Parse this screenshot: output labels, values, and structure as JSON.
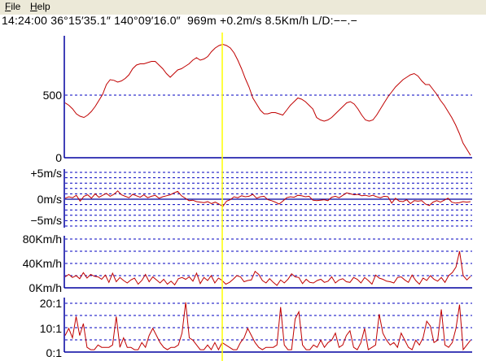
{
  "menu": {
    "file_label": "File",
    "file_mnemonic": "F",
    "file_rest": "ile",
    "help_label": "Help",
    "help_mnemonic": "H",
    "help_rest": "elp"
  },
  "status": {
    "time": "14:24:00",
    "latitude": "36°15′35.1″",
    "longitude": "140°09′16.0″",
    "altitude": "969m",
    "vario": "+0.2m/s",
    "speed": "8.5Km/h",
    "glide": "L/D:−−.−"
  },
  "colors": {
    "trace": "#c00000",
    "axis": "#0000a0",
    "grid": "#0000c0",
    "cursor": "#ffff00",
    "menubar": "#ece9d8"
  },
  "charts": {
    "altitude": {
      "ticks": [
        "500",
        "0"
      ],
      "tick_values": [
        500,
        0
      ],
      "ylim": [
        0,
        1000
      ],
      "values": [
        450,
        430,
        400,
        360,
        340,
        330,
        350,
        380,
        420,
        470,
        520,
        600,
        640,
        635,
        620,
        630,
        650,
        680,
        730,
        760,
        770,
        770,
        780,
        790,
        790,
        760,
        730,
        690,
        660,
        690,
        720,
        730,
        750,
        770,
        800,
        820,
        800,
        810,
        830,
        870,
        900,
        920,
        930,
        920,
        900,
        860,
        800,
        730,
        650,
        580,
        490,
        440,
        390,
        360,
        360,
        370,
        370,
        360,
        350,
        390,
        430,
        460,
        490,
        480,
        460,
        430,
        400,
        330,
        310,
        300,
        310,
        330,
        360,
        390,
        420,
        450,
        460,
        440,
        400,
        350,
        310,
        300,
        310,
        350,
        400,
        450,
        500,
        540,
        580,
        610,
        640,
        660,
        680,
        690,
        670,
        630,
        600,
        600,
        560,
        520,
        470,
        430,
        380,
        330,
        270,
        200,
        120,
        70,
        20
      ]
    },
    "vario": {
      "ticks": [
        "+5m/s",
        "0m/s",
        "−5m/s"
      ],
      "tick_values": [
        5,
        0,
        -5
      ],
      "ylim": [
        -5.5,
        5.5
      ],
      "values": [
        0.2,
        0.5,
        0.3,
        0.8,
        -0.4,
        0.6,
        0.9,
        0.2,
        1.1,
        0.4,
        0.8,
        1.2,
        0.6,
        1.0,
        1.7,
        0.9,
        0.6,
        0.3,
        1.0,
        0.7,
        0.4,
        0.9,
        0.3,
        0.6,
        0.8,
        0.2,
        0.5,
        0.7,
        0.9,
        1.3,
        1.6,
        0.7,
        0.2,
        -0.3,
        -0.2,
        -0.5,
        -0.6,
        -0.7,
        -0.5,
        -0.9,
        -0.6,
        -1.0,
        -1.5,
        -0.4,
        -0.1,
        0.5,
        0.3,
        0.7,
        0.5,
        0.6,
        1.0,
        0.2,
        0.5,
        0.6,
        -0.1,
        -0.3,
        -0.6,
        -1.0,
        -0.4,
        0.3,
        0.5,
        0.4,
        0.8,
        0.7,
        0.5,
        0.6,
        -0.2,
        -0.3,
        -0.2,
        -0.1,
        -0.3,
        0.4,
        0.6,
        0.3,
        0.8,
        1.3,
        1.1,
        0.9,
        1.0,
        0.7,
        0.8,
        0.6,
        0.8,
        0.5,
        0.3,
        0.6,
        0.5,
        -0.8,
        0.2,
        -0.4,
        -0.5,
        -0.1,
        -0.9,
        -0.3,
        -0.4,
        -0.3,
        -1.0,
        -1.3,
        -0.6,
        -0.3,
        -0.6,
        -0.2,
        0.2,
        -0.6,
        -0.8,
        -0.7,
        -0.5,
        -0.6,
        -0.5
      ]
    },
    "speed": {
      "ticks": [
        "80Km/h",
        "40Km/h",
        "0Km/h"
      ],
      "tick_values": [
        80,
        40,
        0
      ],
      "ylim": [
        0,
        80
      ],
      "values": [
        18,
        22,
        17,
        20,
        15,
        25,
        16,
        22,
        19,
        18,
        14,
        21,
        9,
        24,
        10,
        17,
        12,
        8,
        13,
        16,
        6,
        12,
        22,
        10,
        18,
        13,
        8,
        14,
        6,
        11,
        5,
        15,
        17,
        14,
        18,
        11,
        24,
        7,
        17,
        12,
        20,
        8,
        16,
        12,
        6,
        9,
        14,
        20,
        18,
        10,
        12,
        13,
        27,
        22,
        12,
        8,
        15,
        9,
        4,
        13,
        8,
        14,
        23,
        18,
        17,
        7,
        14,
        9,
        8,
        12,
        14,
        9,
        11,
        18,
        8,
        13,
        15,
        10,
        9,
        17,
        14,
        8,
        17,
        12,
        6,
        21,
        16,
        14,
        11,
        10,
        8,
        17,
        18,
        13,
        9,
        21,
        12,
        6,
        16,
        12,
        20,
        14,
        11,
        17,
        9,
        20,
        25,
        34,
        60,
        20,
        13,
        19
      ]
    },
    "glide": {
      "ticks": [
        "20:1",
        "10:1",
        "0:1"
      ],
      "tick_values": [
        20,
        10,
        0
      ],
      "ylim": [
        0,
        23
      ],
      "values": [
        7,
        10,
        6,
        15,
        7,
        12,
        2,
        1,
        1,
        3,
        2,
        2,
        2,
        3,
        15,
        2,
        6,
        2,
        2,
        1,
        1,
        4,
        2,
        7,
        10,
        7,
        4,
        2,
        1,
        2,
        2,
        3,
        8,
        21,
        6,
        5,
        3,
        1,
        1,
        3,
        1,
        4,
        1,
        4,
        3,
        2,
        1,
        1,
        4,
        6,
        10,
        7,
        4,
        2,
        1,
        2,
        2,
        2,
        3,
        19,
        3,
        1,
        1,
        14,
        17,
        3,
        1,
        1,
        3,
        2,
        5,
        2,
        4,
        5,
        8,
        2,
        3,
        7,
        9,
        2,
        1,
        4,
        10,
        1,
        2,
        3,
        16,
        8,
        5,
        3,
        4,
        2,
        8,
        5,
        2,
        1,
        5,
        3,
        6,
        13,
        11,
        4,
        5,
        18,
        3,
        2,
        4,
        10,
        20,
        1,
        3,
        5
      ]
    }
  }
}
